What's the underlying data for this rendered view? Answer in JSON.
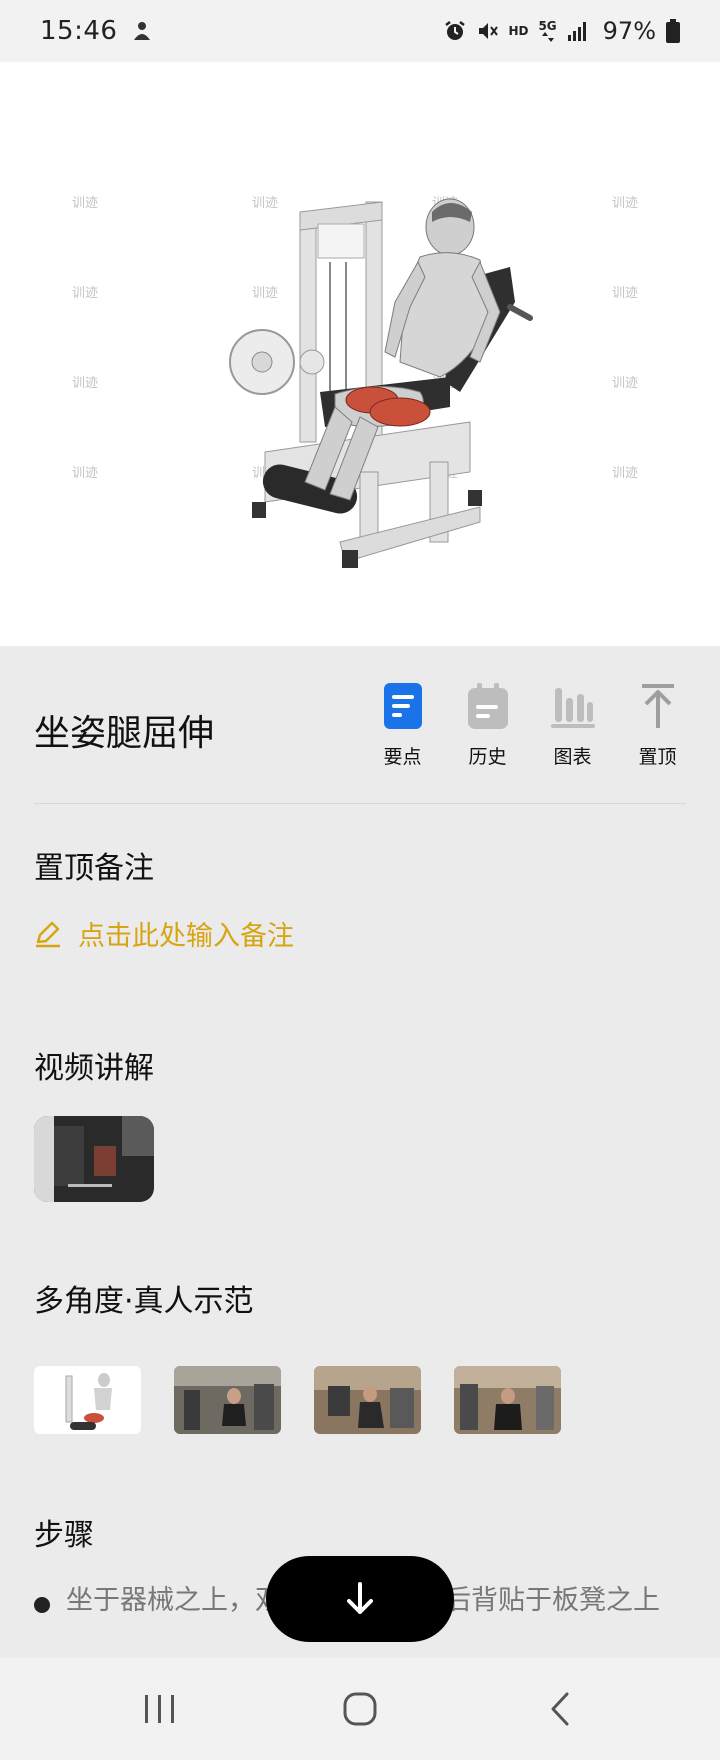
{
  "status_bar": {
    "time": "15:46",
    "network_hd": "HD",
    "network_5g": "5G",
    "battery": "97%",
    "icons": [
      "app-notification-icon",
      "alarm-icon",
      "mute-icon",
      "signal-icon",
      "battery-icon"
    ]
  },
  "hero": {
    "watermark": "训迹",
    "image": "seated-leg-extension-illustration"
  },
  "exercise": {
    "title": "坐姿腿屈伸"
  },
  "actions": [
    {
      "label": "要点",
      "icon": "document-icon",
      "color": "#1a73e8"
    },
    {
      "label": "历史",
      "icon": "calendar-icon",
      "color": "#bdbdbd"
    },
    {
      "label": "图表",
      "icon": "bar-chart-icon",
      "color": "#bdbdbd"
    },
    {
      "label": "置顶",
      "icon": "pin-top-icon",
      "color": "#9e9e9e"
    }
  ],
  "notes": {
    "title": "置顶备注",
    "placeholder": "点击此处输入备注",
    "accent": "#d7a514"
  },
  "video": {
    "title": "视频讲解"
  },
  "demos": {
    "title": "多角度·真人示范"
  },
  "steps": {
    "title": "步骤",
    "items": [
      "坐于器械之上，双手握住把手，后背贴于板凳之上"
    ]
  },
  "nav": {
    "icons": [
      "recent-apps-icon",
      "home-icon",
      "back-icon"
    ]
  }
}
